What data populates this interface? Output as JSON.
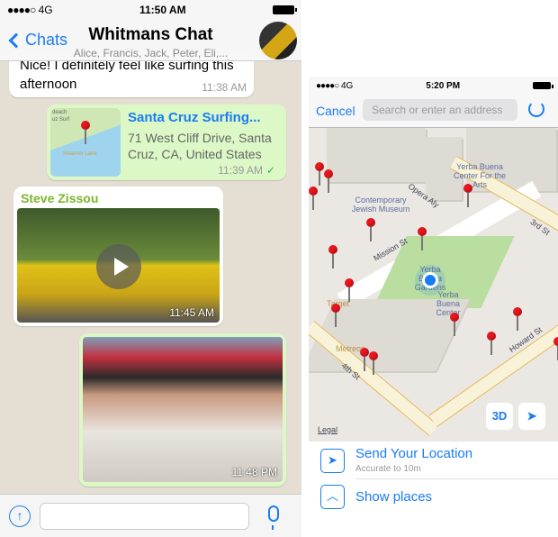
{
  "chat": {
    "status": {
      "signal": "●●●●○",
      "network": "4G",
      "time": "11:50 AM"
    },
    "header": {
      "back_label": "Chats",
      "title": "Whitmans Chat",
      "participants": "Alice, Francis, Jack, Peter, Eli,..."
    },
    "messages": [
      {
        "type": "text",
        "text": "Nice! I definitely feel like surfing this afternoon",
        "time": "11:38 AM"
      },
      {
        "type": "location",
        "map_labels": [
          "deach",
          "uz Surf",
          "Steamer Lane"
        ],
        "title": "Santa Cruz Surfing...",
        "address": "71 West Cliff Drive, Santa Cruz, CA, United States",
        "time": "11:39 AM",
        "status": "✓"
      },
      {
        "type": "video",
        "sender": "Steve Zissou",
        "time": "11:45 AM"
      },
      {
        "type": "image",
        "time": "11:48 PM"
      }
    ],
    "input": {
      "placeholder": "",
      "attach_icon": "↑"
    }
  },
  "location_picker": {
    "status": {
      "signal": "●●●●○",
      "network": "4G",
      "time": "5:20 PM"
    },
    "header": {
      "cancel_label": "Cancel",
      "search_placeholder": "Search or enter an address"
    },
    "map": {
      "labels": {
        "cjm": "Contemporary Jewish Museum",
        "ybca": "Yerba Buena Center For the Arts",
        "opera": "Opera Aly",
        "mission": "Mission St",
        "third": "3rd St",
        "ybg": "Yerba Buena Gardens",
        "ybc": "Yerba Buena Center",
        "target": "Target",
        "metreon": "Metreon",
        "fourth": "4th St",
        "howard": "Howard St",
        "legal": "Legal"
      },
      "btn_3d": "3D"
    },
    "options": [
      {
        "title": "Send Your Location",
        "subtitle": "Accurate to 10m",
        "icon": "location-arrow"
      },
      {
        "title": "Show places",
        "icon": "chevron-up"
      }
    ],
    "accent": "#1a7cf5"
  }
}
